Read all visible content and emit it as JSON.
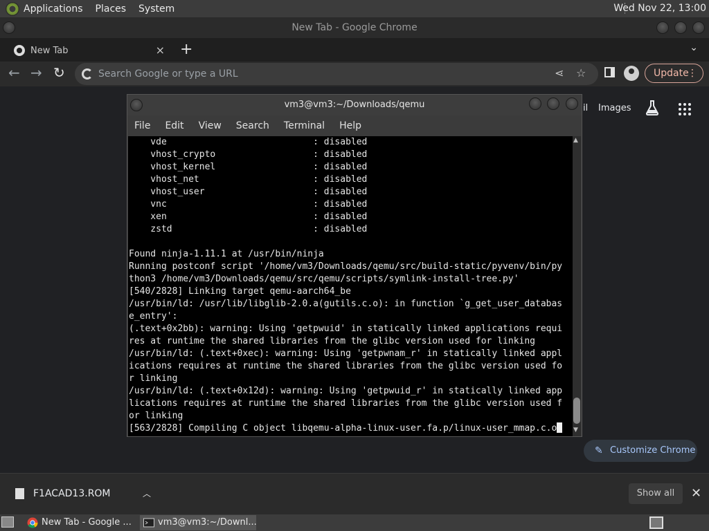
{
  "top_panel": {
    "menus": [
      "Applications",
      "Places",
      "System"
    ],
    "clock": "Wed Nov 22, 13:00"
  },
  "chrome": {
    "window_title": "New Tab - Google Chrome",
    "tab_title": "New Tab",
    "tab_close": "×",
    "new_tab": "+",
    "tab_search": "⌄",
    "omnibox_placeholder": "Search Google or type a URL",
    "update_label": "Update",
    "update_menu": "⋮",
    "page_links": {
      "gmail_fragment": "il",
      "images": "Images"
    },
    "customize_label": "Customize Chrome"
  },
  "terminal": {
    "title": "vm3@vm3:~/Downloads/qemu",
    "menus": [
      "File",
      "Edit",
      "View",
      "Search",
      "Terminal",
      "Help"
    ],
    "lines": [
      "    vde                           : disabled",
      "    vhost_crypto                  : disabled",
      "    vhost_kernel                  : disabled",
      "    vhost_net                     : disabled",
      "    vhost_user                    : disabled",
      "    vnc                           : disabled",
      "    xen                           : disabled",
      "    zstd                          : disabled",
      "",
      "Found ninja-1.11.1 at /usr/bin/ninja",
      "Running postconf script '/home/vm3/Downloads/qemu/src/build-static/pyvenv/bin/py",
      "thon3 /home/vm3/Downloads/qemu/src/qemu/scripts/symlink-install-tree.py'",
      "[540/2828] Linking target qemu-aarch64_be",
      "/usr/bin/ld: /usr/lib/libglib-2.0.a(gutils.c.o): in function `g_get_user_databas",
      "e_entry':",
      "(.text+0x2bb): warning: Using 'getpwuid' in statically linked applications requi",
      "res at runtime the shared libraries from the glibc version used for linking",
      "/usr/bin/ld: (.text+0xec): warning: Using 'getpwnam_r' in statically linked appl",
      "ications requires at runtime the shared libraries from the glibc version used fo",
      "r linking",
      "/usr/bin/ld: (.text+0x12d): warning: Using 'getpwuid_r' in statically linked app",
      "lications requires at runtime the shared libraries from the glibc version used f",
      "or linking"
    ],
    "last_line": "[563/2828] Compiling C object libqemu-alpha-linux-user.fa.p/linux-user_mmap.c.o"
  },
  "downloads": {
    "file_name": "F1ACAD13.ROM",
    "show_all": "Show all",
    "close": "✕"
  },
  "taskbar": {
    "tasks": [
      "New Tab - Google ...",
      "vm3@vm3:~/Downl..."
    ]
  }
}
